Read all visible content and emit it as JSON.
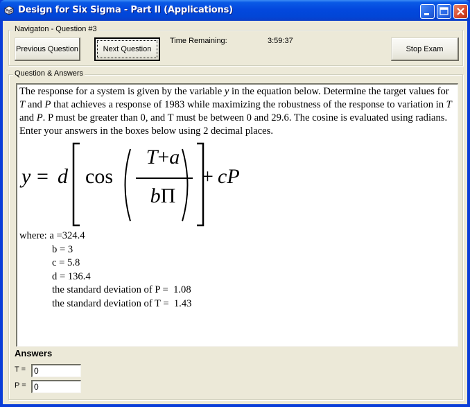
{
  "window": {
    "title": "Design for Six Sigma - Part II (Applications)",
    "app_icon": "dice-icon",
    "controls": [
      "minimize",
      "maximize",
      "close"
    ]
  },
  "navigation": {
    "group_label": "Navigaton - Question #3",
    "previous_label": "Previous Question",
    "next_label": "Next Question",
    "time_label": "Time Remaining:",
    "time_value": "3:59:37",
    "stop_label": "Stop Exam"
  },
  "question": {
    "group_label": "Question & Answers",
    "text_parts": [
      "The response for a system is given by the variable ",
      "y",
      " in the equation below.  Determine the target values for ",
      "T",
      " and ",
      "P",
      " that achieves a response of 1983 while maximizing the robustness of the response to variation in ",
      "T",
      " and ",
      "P",
      ". P must be greater than 0, and T must be between 0 and 29.6.   The cosine is evaluated using radians.  Enter your answers in the boxes below using 2 decimal places."
    ],
    "equation": {
      "lhs": "y",
      "equals": "=",
      "coef": "d",
      "func": "cos",
      "numerator_var": "T",
      "numerator_op": "+",
      "numerator_const": "a",
      "denominator_var": "b",
      "denominator_const": "Π",
      "plus": "+",
      "tail": "cP"
    },
    "where": {
      "prefix": "where: ",
      "lines": [
        "a =324.4",
        "b = 3",
        "c = 5.8",
        "d = 136.4",
        "the standard deviation of P =  1.08",
        "the standard deviation of T =  1.43"
      ]
    }
  },
  "answers": {
    "title": "Answers",
    "t_label": "T =",
    "t_value": "0",
    "p_label": "P =",
    "p_value": "0"
  }
}
